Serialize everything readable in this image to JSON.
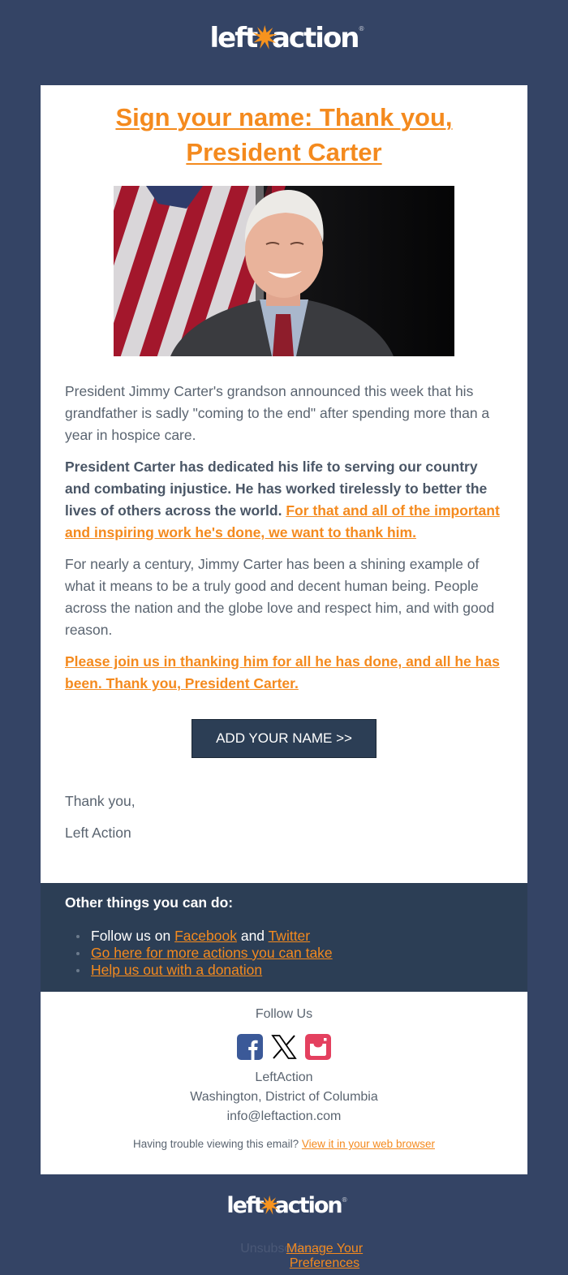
{
  "brand": {
    "logo_left": "left",
    "logo_right": "action",
    "registered": "®",
    "accent_color": "#f48a1e",
    "background_color": "#344465",
    "dark_panel_color": "#2c3e55"
  },
  "headline": {
    "line1": "Sign your name: Thank you,",
    "line2": "President Carter"
  },
  "hero_image": {
    "alt": "President Jimmy Carter smiling in front of an American flag"
  },
  "body": {
    "p1": "President Jimmy Carter's grandson announced this week that his grandfather is sadly \"coming to the end\" after spending more than a year in hospice care.",
    "p2_bold": "President Carter has dedicated his life to serving our country and combating injustice. He has worked tirelessly to better the lives of others across the world.",
    "p2_link": "For that and all of the important and inspiring work he's done, we want to thank him.",
    "p3": "For nearly a century, Jimmy Carter has been a shining example of what it means to be a truly good and decent human being. People across the nation and the globe love and respect him, and with good reason.",
    "p4_link": "Please join us in thanking him for all he has done, and all he has been. Thank you, President Carter."
  },
  "cta": {
    "label": "ADD YOUR NAME >>"
  },
  "signoff": {
    "line1": "Thank you,",
    "line2": "Left Action"
  },
  "other_things": {
    "title": "Other things you can do:",
    "item1_prefix": "Follow us on ",
    "item1_link1": "Facebook",
    "item1_mid": " and ",
    "item1_link2": "Twitter",
    "item2_link": "Go here for more actions you can take",
    "item3_link": "Help us out with a donation"
  },
  "footer": {
    "follow_title": "Follow Us",
    "social": [
      {
        "name": "facebook",
        "color": "#3b5998"
      },
      {
        "name": "x",
        "color": "#000000"
      },
      {
        "name": "instagram",
        "color": "#e4405f"
      }
    ],
    "org_name": "LeftAction",
    "org_location": "Washington, District of Columbia",
    "org_email": "info@leftaction.com",
    "trouble_text": "Having trouble viewing this email? ",
    "trouble_link": "View it in your web browser"
  },
  "unsubscribe": {
    "text": "Unsubscribe or ",
    "link": "Manage Your Preferences"
  }
}
